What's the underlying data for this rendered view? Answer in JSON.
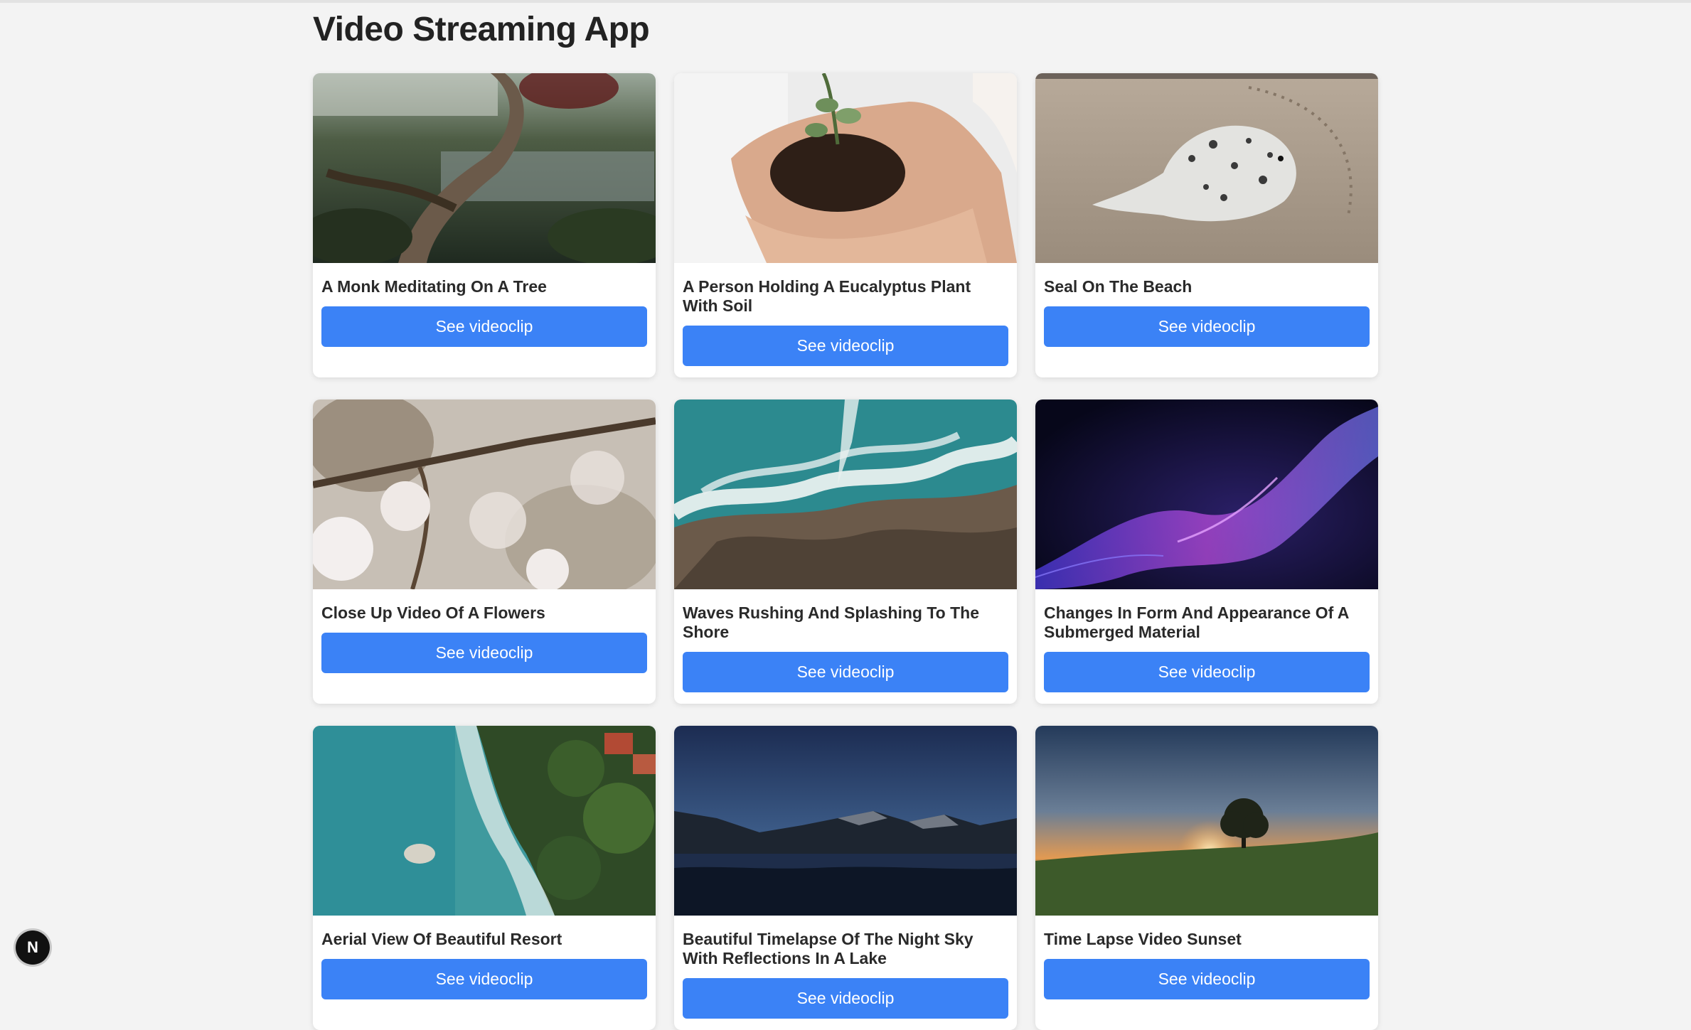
{
  "app": {
    "title": "Video Streaming App"
  },
  "videos": [
    {
      "title": "A Monk Meditating On A Tree",
      "button": "See videoclip"
    },
    {
      "title": "A Person Holding A Eucalyptus Plant With Soil",
      "button": "See videoclip"
    },
    {
      "title": "Seal On The Beach",
      "button": "See videoclip"
    },
    {
      "title": "Close Up Video Of A Flowers",
      "button": "See videoclip"
    },
    {
      "title": "Waves Rushing And Splashing To The Shore",
      "button": "See videoclip"
    },
    {
      "title": "Changes In Form And Appearance Of A Submerged Material",
      "button": "See videoclip"
    },
    {
      "title": "Aerial View Of Beautiful Resort",
      "button": "See videoclip"
    },
    {
      "title": "Beautiful Timelapse Of The Night Sky With Reflections In A Lake",
      "button": "See videoclip"
    },
    {
      "title": "Time Lapse Video Sunset",
      "button": "See videoclip"
    }
  ],
  "dev_badge": {
    "label": "N"
  }
}
